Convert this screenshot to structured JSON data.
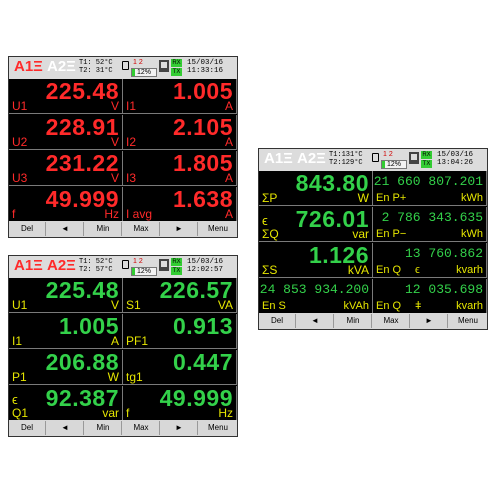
{
  "header_a": {
    "ch1": "A1Ξ",
    "ch2": "A2Ξ",
    "t1": "T1: 52°C",
    "t2": "T2: 31°C",
    "tariff": "1  2",
    "bar_pct": "12%",
    "bar_fraction": 0.12,
    "rx": "RX",
    "tx": "TX",
    "date": "15/03/16",
    "time": "11:33:16"
  },
  "header_b": {
    "ch1": "A1Ξ",
    "ch2": "A2Ξ",
    "t1": "T1: 52°C",
    "t2": "T2: 57°C",
    "tariff": "1  2",
    "bar_pct": "12%",
    "bar_fraction": 0.12,
    "rx": "RX",
    "tx": "TX",
    "date": "15/03/16",
    "time": "12:02:57"
  },
  "header_c": {
    "ch1": "A1Ξ",
    "ch2": "A2Ξ",
    "t1": "T1:131°C",
    "t2": "T2:129°C",
    "tariff": "1  2",
    "bar_pct": "12%",
    "bar_fraction": 0.12,
    "rx": "RX",
    "tx": "TX",
    "date": "15/03/16",
    "time": "13:04:26"
  },
  "screen_a": {
    "cells": [
      {
        "value": "225.48",
        "label": "U1",
        "unit": "V"
      },
      {
        "value": "1.005",
        "label": "I1",
        "unit": "A"
      },
      {
        "value": "228.91",
        "label": "U2",
        "unit": "V"
      },
      {
        "value": "2.105",
        "label": "I2",
        "unit": "A"
      },
      {
        "value": "231.22",
        "label": "U3",
        "unit": "V"
      },
      {
        "value": "1.805",
        "label": "I3",
        "unit": "A"
      },
      {
        "value": "49.999",
        "label": "f",
        "unit": "Hz"
      },
      {
        "value": "1.638",
        "label": "I avg",
        "unit": "A"
      }
    ]
  },
  "screen_b": {
    "cells": [
      {
        "value": "225.48",
        "label": "U1",
        "unit": "V"
      },
      {
        "value": "226.57",
        "label": "S1",
        "unit": "VA"
      },
      {
        "value": "1.005",
        "label": "I1",
        "unit": "A"
      },
      {
        "value": "0.913",
        "label": "PF1",
        "unit": ""
      },
      {
        "value": "206.88",
        "label": "P1",
        "unit": "W"
      },
      {
        "value": "0.447",
        "label": "tg1",
        "unit": ""
      },
      {
        "value": "92.387",
        "label": "Q1",
        "unit": "var"
      },
      {
        "value": "49.999",
        "label": "f",
        "unit": "Hz"
      }
    ]
  },
  "screen_c": {
    "cells": [
      {
        "value": "843.80",
        "label": "ΣP",
        "unit": "W"
      },
      {
        "value": "21 660 807.201",
        "label": "En P+",
        "unit": "kWh"
      },
      {
        "value": "726.01",
        "label": "ΣQ",
        "unit": "var"
      },
      {
        "value": "2 786 343.635",
        "label": "En P−",
        "unit": "kWh"
      },
      {
        "value": "1.126",
        "label": "ΣS",
        "unit": "kVA"
      },
      {
        "value": "13 760.862",
        "label": "En Q",
        "unit": "kvarh"
      },
      {
        "value": "24 853 934.200",
        "label": "En S",
        "unit": "kVAh"
      },
      {
        "value": "12 035.698",
        "label": "En Q",
        "unit": "kvarh"
      }
    ]
  },
  "footer": {
    "del": "Del",
    "left": "◄",
    "min": "Min",
    "max": "Max",
    "right": "►",
    "menu": "Menu"
  },
  "colors": {
    "red": "#ff2a2a",
    "green": "#33d14a",
    "yellow": "#e6e600",
    "screen_bg": "#000000",
    "bar_bg": "#dcdcdc"
  },
  "icons": {
    "inductive": "inductive-load-icon",
    "capacitive": "capacitive-load-icon",
    "memory": "memory-card-icon",
    "network": "network-icon"
  }
}
